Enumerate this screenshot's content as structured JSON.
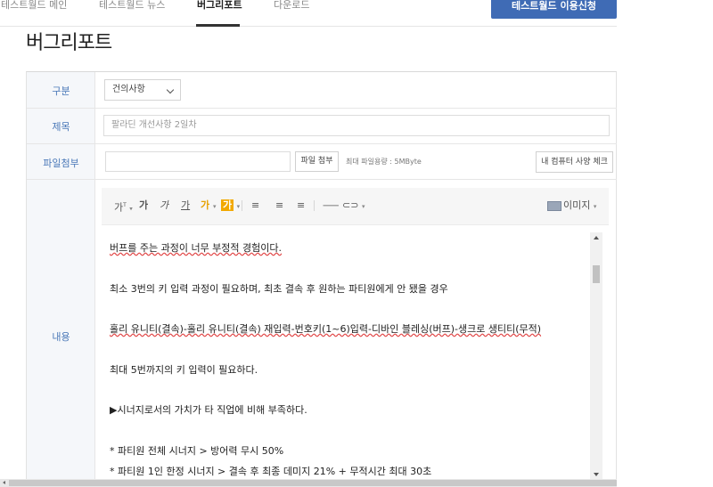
{
  "nav": {
    "items": [
      "테스트월드 메인",
      "테스트월드 뉴스",
      "버그리포트",
      "다운로드"
    ],
    "active": "버그리포트",
    "apply_button": "테스트월드 이용신청"
  },
  "page_title": "버그리포트",
  "form": {
    "category": {
      "label": "구분",
      "selected": "건의사항"
    },
    "title": {
      "label": "제목",
      "placeholder": "팔라딘 개선사항 2일차"
    },
    "file": {
      "label": "파일첨부",
      "attach_button": "파일 첨부",
      "max_size_note": "최대 파일용량 : 5MByte",
      "spec_check_button": "내 컴퓨터 사양 체크"
    },
    "content": {
      "label": "내용",
      "toolbar": {
        "font_size": "가",
        "bold": "가",
        "italic": "가",
        "underline": "가",
        "font_color": "가",
        "highlight": "가",
        "image_button": "이미지"
      },
      "lines": [
        "버프를 주는 과정이 너무 부정적 경험이다.",
        "최소 3번의 키 입력 과정이 필요하며, 최초 결속 후 원하는 파티원에게 안 됐을 경우",
        "홀리 유니티(결속)-홀리 유니티(결속) 재입력-번호키(1~6)입력-디바인 블레싱(버프)-생크로 생티티(무적)",
        "최대 5번까지의 키 입력이 필요하다.",
        "▶시너지로서의 가치가 타 직업에 비해 부족하다.",
        "* 파티원 전체 시너지 > 방어력 무시 50%",
        "* 파티원 1인 한정 시너지 > 결속 후 최종 데미지 21% + 무적시간 최대 30초"
      ]
    }
  },
  "colors": {
    "accent": "#3f6bb5",
    "label": "#4a78b8",
    "highlight": "#f2a900"
  }
}
